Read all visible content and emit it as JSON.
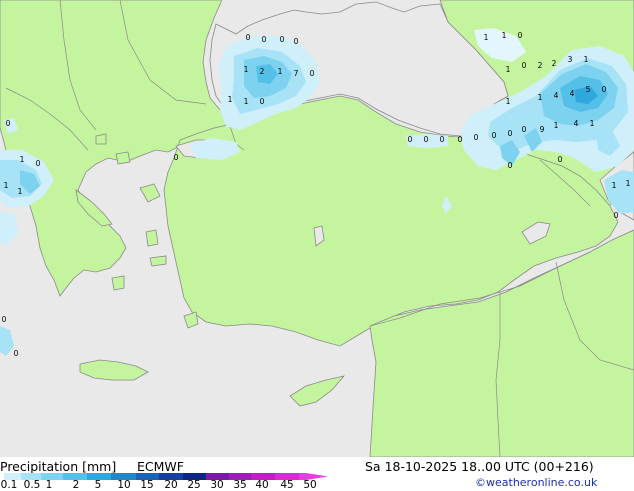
{
  "map": {
    "sea_color": "#e9e9e9",
    "land_color": "#c4f59e",
    "border_color": "#8a8a8a",
    "cell_labels": [
      "0",
      "1",
      "2",
      "3",
      "4",
      "5",
      "7",
      "8",
      "9"
    ]
  },
  "footer": {
    "title": "Precipitation [mm]",
    "model": "ECMWF",
    "datetime": "Sa 18-10-2025 18..00 UTC (00+216)",
    "credit": "©weatheronline.co.uk"
  },
  "legend": {
    "ticks": [
      "0.1",
      "0.5",
      "1",
      "2",
      "5",
      "10",
      "15",
      "20",
      "25",
      "30",
      "35",
      "40",
      "45",
      "50"
    ],
    "colors": [
      "#cfeffb",
      "#a8e2f6",
      "#7dd2ef",
      "#54c0e7",
      "#2ea8de",
      "#1f86c9",
      "#1b64b5",
      "#16409e",
      "#0f2585",
      "#7a1ca6",
      "#9d1fb8",
      "#c01fc8",
      "#d72cd4",
      "#e63ce0"
    ]
  }
}
